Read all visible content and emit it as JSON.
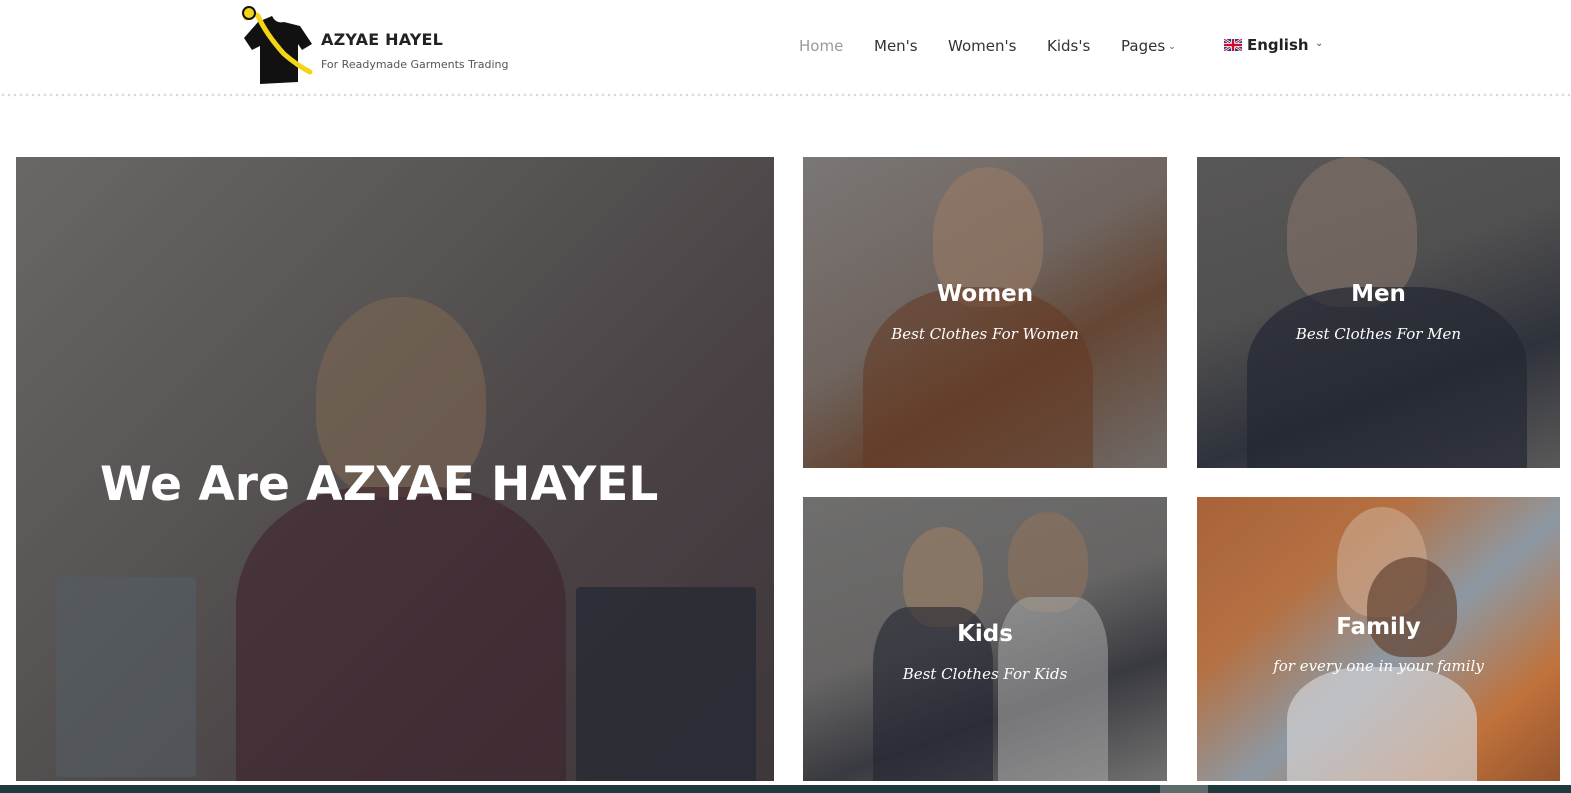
{
  "brand": {
    "name": "AZYAE HAYEL",
    "tagline": "For Readymade Garments Trading",
    "logo_icon": "tshirt-hanger-logo"
  },
  "nav": {
    "items": [
      {
        "label": "Home",
        "active": true
      },
      {
        "label": "Men's",
        "active": false
      },
      {
        "label": "Women's",
        "active": false
      },
      {
        "label": "Kids's",
        "active": false
      },
      {
        "label": "Pages",
        "active": false,
        "has_dropdown": true
      }
    ],
    "language": {
      "label": "English",
      "flag_icon": "uk-flag-icon"
    }
  },
  "hero": {
    "title": "We Are AZYAE HAYEL"
  },
  "categories": [
    {
      "title": "Women",
      "subtitle": "Best Clothes For Women"
    },
    {
      "title": "Men",
      "subtitle": "Best Clothes For Men"
    },
    {
      "title": "Kids",
      "subtitle": "Best Clothes For Kids"
    },
    {
      "title": "Family",
      "subtitle": "for every one in your family"
    }
  ],
  "colors": {
    "logo_yellow": "#f2d516",
    "logo_black": "#111111",
    "nav_active": "#9a9a9a",
    "text_dark": "#222222"
  }
}
